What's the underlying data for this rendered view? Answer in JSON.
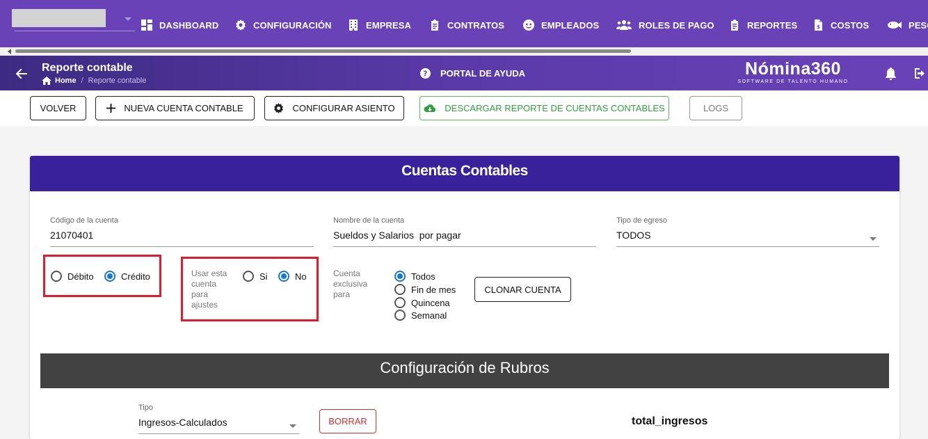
{
  "nav": {
    "items": [
      {
        "label": "DASHBOARD",
        "icon": "dashboard-icon"
      },
      {
        "label": "CONFIGURACIÓN",
        "icon": "gear-icon"
      },
      {
        "label": "EMPRESA",
        "icon": "building-icon"
      },
      {
        "label": "CONTRATOS",
        "icon": "clipboard-icon"
      },
      {
        "label": "EMPLEADOS",
        "icon": "people-face-icon"
      },
      {
        "label": "ROLES DE PAGO",
        "icon": "users-icon"
      },
      {
        "label": "REPORTES",
        "icon": "clipboard-icon"
      },
      {
        "label": "COSTOS",
        "icon": "invoice-icon"
      },
      {
        "label": "PESC",
        "icon": "fish-icon"
      }
    ]
  },
  "header": {
    "title": "Reporte contable",
    "breadcrumb_home": "Home",
    "breadcrumb_sep": "/",
    "breadcrumb_current": "Reporte contable",
    "help": "PORTAL DE AYUDA",
    "logo": "Nómina360",
    "logo_sub": "SOFTWARE DE TALENTO HUMANO"
  },
  "toolbar": {
    "volver": "VOLVER",
    "nueva": "NUEVA CUENTA CONTABLE",
    "configurar": "CONFIGURAR ASIENTO",
    "descargar": "DESCARGAR REPORTE DE CUENTAS CONTABLES",
    "logs": "LOGS"
  },
  "card": {
    "title": "Cuentas Contables",
    "codigo": {
      "label": "Código de la cuenta",
      "value": "21070401"
    },
    "nombre": {
      "label": "Nombre de la cuenta",
      "value": "Sueldos y Salarios  por pagar"
    },
    "tipo_egreso": {
      "label": "Tipo de egreso",
      "value": "TODOS"
    },
    "naturaleza": {
      "debito": "Débito",
      "credito": "Crédito",
      "selected": "Crédito"
    },
    "ajustes": {
      "label": "Usar esta cuenta para ajustes",
      "label_lines": [
        "Usar esta",
        "cuenta",
        "para",
        "ajustes"
      ],
      "si": "Si",
      "no": "No",
      "selected": "No"
    },
    "exclusiva": {
      "label_lines": [
        "Cuenta",
        "exclusiva",
        "para"
      ],
      "options": [
        "Todos",
        "Fin de mes",
        "Quincena",
        "Semanal"
      ],
      "selected": "Todos"
    },
    "clonar": "CLONAR CUENTA"
  },
  "rubros": {
    "title": "Configuración de Rubros",
    "tipo": {
      "label": "Tipo",
      "value": "Ingresos-Calculados"
    },
    "borrar": "BORRAR",
    "total": "total_ingresos"
  },
  "colors": {
    "nav": "#6a42b8",
    "card_header": "#3a219c",
    "accent": "#1976d2",
    "highlight": "#e21b2c",
    "success": "#2e9e3e"
  }
}
